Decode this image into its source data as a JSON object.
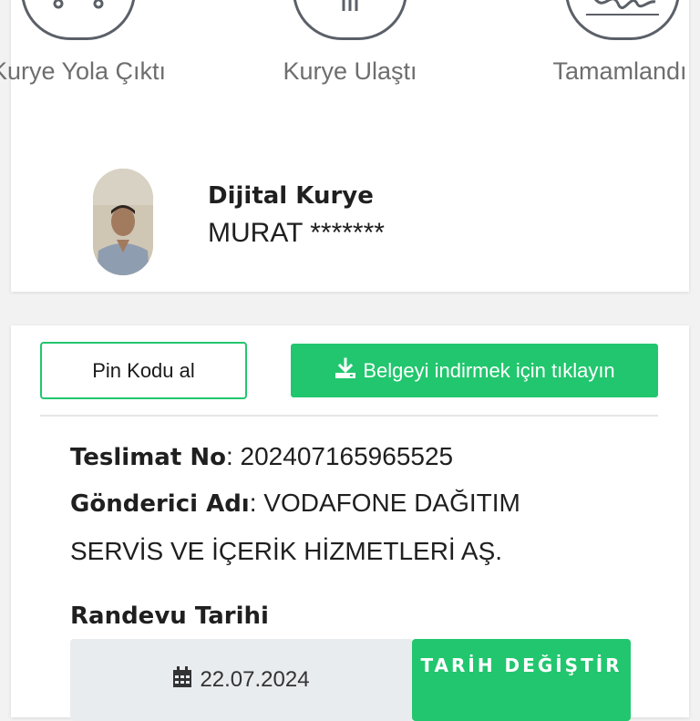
{
  "status_steps": [
    {
      "label": "Kurye Yola Çıktı",
      "icon": "scooter-icon"
    },
    {
      "label": "Kurye Ulaştı",
      "icon": "building-icon"
    },
    {
      "label": "Tamamlandı",
      "icon": "signature-icon"
    }
  ],
  "courier": {
    "title": "Dijital Kurye",
    "name": "MURAT *******"
  },
  "actions": {
    "pin_label": "Pin Kodu al",
    "download_label": "Belgeyi indirmek için tıklayın",
    "download_icon": "download-icon"
  },
  "delivery": {
    "number_label": "Teslimat No",
    "number_value": "202407165965525",
    "sender_label": "Gönderici Adı",
    "sender_value": "VODAFONE DAĞITIM SERVİS VE İÇERİK HİZMETLERİ AŞ.",
    "appointment_label": "Randevu Tarihi",
    "appointment_date": "22.07.2024",
    "calendar_icon": "calendar-icon",
    "change_date_label": "TARİH DEĞİŞTİR"
  },
  "colors": {
    "accent": "#22c66e",
    "step_outline": "#5b6068"
  }
}
